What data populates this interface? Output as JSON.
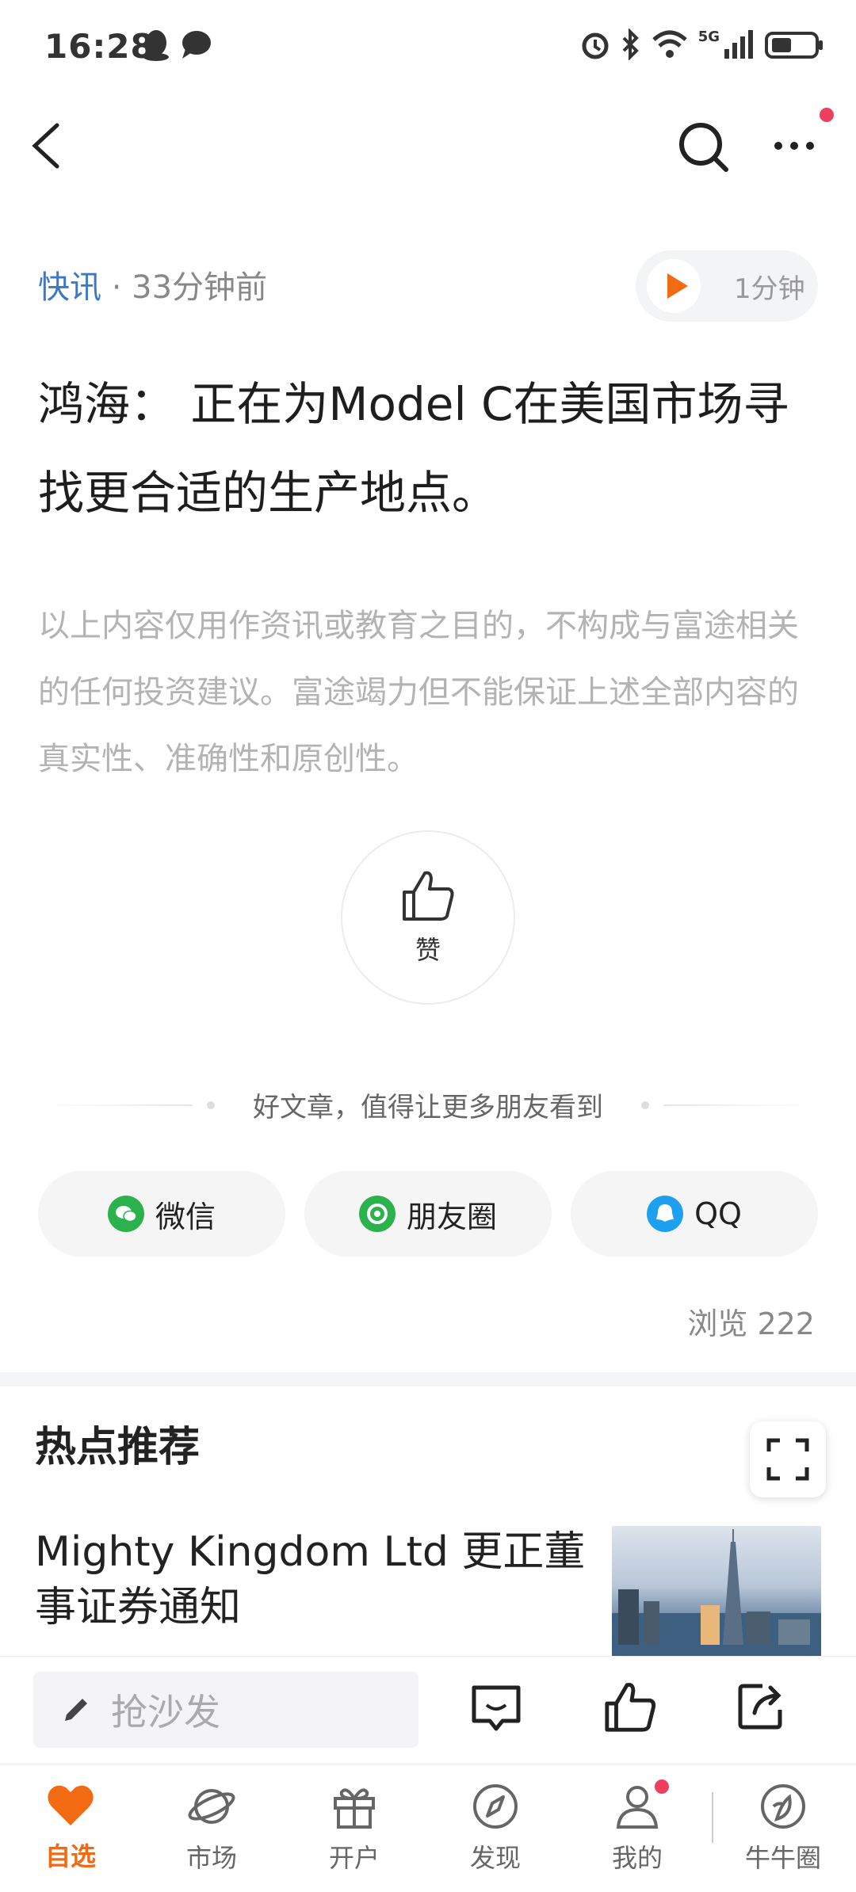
{
  "status_bar": {
    "time": "16:28",
    "network": "5G"
  },
  "article": {
    "category": "快讯",
    "time_ago": "· 33分钟前",
    "audio_duration": "1分钟",
    "title": "鸿海： 正在为Model C在美国市场寻找更合适的生产地点。",
    "disclaimer": "以上内容仅用作资讯或教育之目的，不构成与富途相关的任何投资建议。富途竭力但不能保证上述全部内容的真实性、准确性和原创性。",
    "like_label": "赞",
    "share_tip": "好文章，值得让更多朋友看到",
    "share_buttons": [
      {
        "label": "微信",
        "icon": "wechat-icon",
        "color": "#2bb24c"
      },
      {
        "label": "朋友圈",
        "icon": "moments-icon",
        "color": "#2bb24c"
      },
      {
        "label": "QQ",
        "icon": "qq-icon",
        "color": "#1ea0f0"
      }
    ],
    "views": "浏览  222"
  },
  "hot": {
    "title": "热点推荐",
    "items": [
      {
        "text": "Mighty Kingdom Ltd 更正董事证券通知"
      }
    ]
  },
  "comment_bar": {
    "placeholder": "抢沙发"
  },
  "tabs": [
    {
      "label": "自选",
      "icon": "heart-icon",
      "active": true
    },
    {
      "label": "市场",
      "icon": "planet-icon"
    },
    {
      "label": "开户",
      "icon": "gift-icon"
    },
    {
      "label": "发现",
      "icon": "compass-icon"
    },
    {
      "label": "我的",
      "icon": "person-icon"
    },
    {
      "label": "牛牛圈",
      "icon": "niuniu-icon"
    }
  ],
  "colors": {
    "accent": "#f26a12",
    "link": "#3b79c6",
    "badge": "#ef3f5f"
  }
}
